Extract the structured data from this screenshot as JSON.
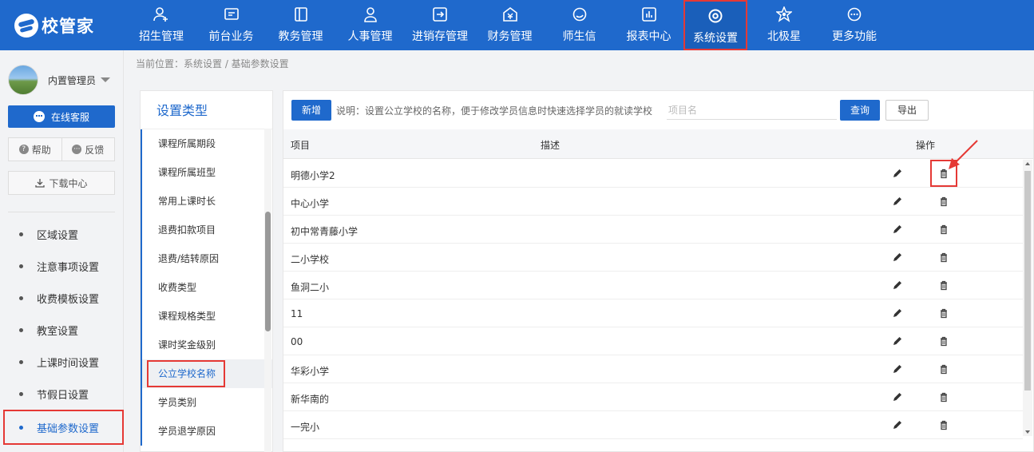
{
  "logo": {
    "text": "校管家"
  },
  "nav": [
    {
      "label": "招生管理",
      "icon": "user-plus-icon"
    },
    {
      "label": "前台业务",
      "icon": "monitor-icon"
    },
    {
      "label": "教务管理",
      "icon": "book-icon"
    },
    {
      "label": "人事管理",
      "icon": "person-icon"
    },
    {
      "label": "进销存管理",
      "icon": "inventory-icon"
    },
    {
      "label": "财务管理",
      "icon": "finance-icon"
    },
    {
      "label": "师生信",
      "icon": "chat-icon"
    },
    {
      "label": "报表中心",
      "icon": "report-icon"
    },
    {
      "label": "系统设置",
      "icon": "settings-icon",
      "active": true
    },
    {
      "label": "北极星",
      "icon": "star-icon"
    },
    {
      "label": "更多功能",
      "icon": "more-icon"
    }
  ],
  "breadcrumb": "当前位置：系统设置 / 基础参数设置",
  "user": {
    "name": "内置管理员"
  },
  "sidebar": {
    "service": "在线客服",
    "help": "帮助",
    "feedback": "反馈",
    "download": "下载中心",
    "items": [
      {
        "label": "区域设置"
      },
      {
        "label": "注意事项设置"
      },
      {
        "label": "收费模板设置"
      },
      {
        "label": "教室设置"
      },
      {
        "label": "上课时间设置"
      },
      {
        "label": "节假日设置"
      },
      {
        "label": "基础参数设置",
        "active": true
      }
    ]
  },
  "types": {
    "title": "设置类型",
    "items": [
      {
        "label": "课程所属期段"
      },
      {
        "label": "课程所属班型"
      },
      {
        "label": "常用上课时长"
      },
      {
        "label": "退费扣款项目"
      },
      {
        "label": "退费/结转原因"
      },
      {
        "label": "收费类型"
      },
      {
        "label": "课程规格类型"
      },
      {
        "label": "课时奖金级别"
      },
      {
        "label": "公立学校名称",
        "active": true
      },
      {
        "label": "学员类别"
      },
      {
        "label": "学员退学原因"
      }
    ]
  },
  "toolbar": {
    "add": "新增",
    "desc": "说明：设置公立学校的名称，便于修改学员信息时快速选择学员的就读学校",
    "search_placeholder": "项目名",
    "query": "查询",
    "export": "导出"
  },
  "table": {
    "columns": [
      "项目",
      "描述",
      "操作"
    ],
    "rows": [
      "明德小学2",
      "中心小学",
      "初中常青藤小学",
      "二小学校",
      "鱼洞二小",
      "11",
      "00",
      "华彩小学",
      "新华南的",
      "一完小"
    ]
  },
  "colors": {
    "primary": "#1f69cc",
    "highlight": "#e53935"
  }
}
